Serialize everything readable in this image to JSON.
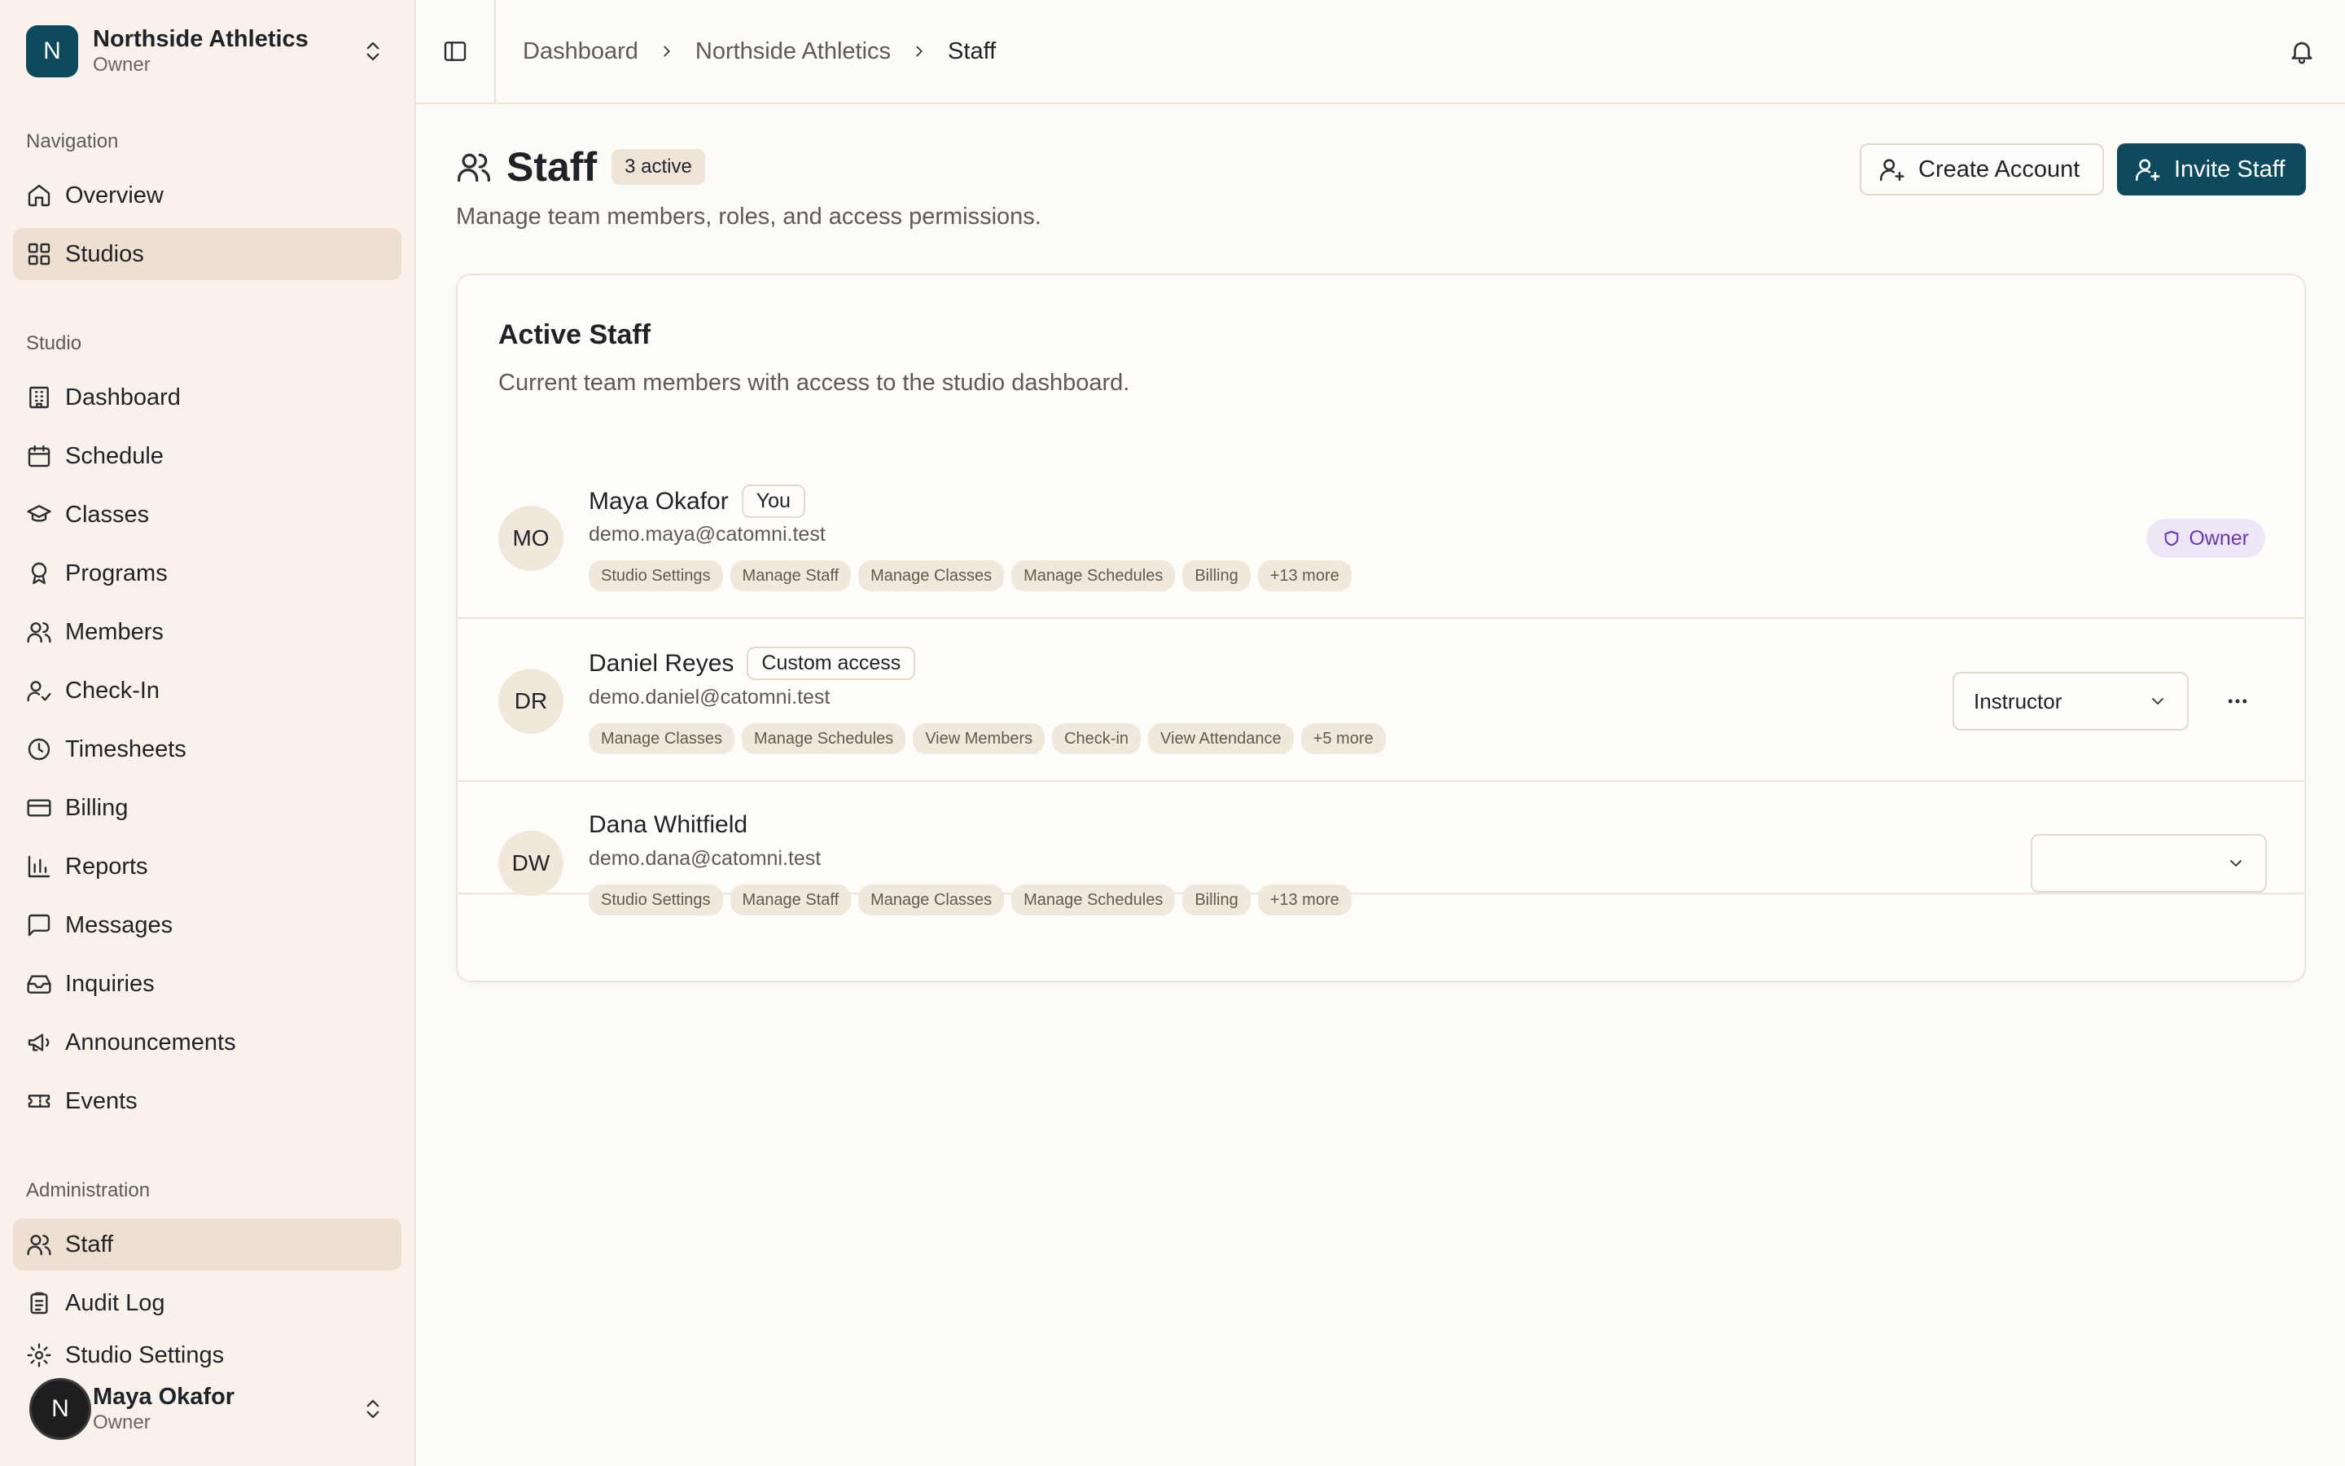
{
  "org": {
    "initial": "N",
    "name": "Northside Athletics",
    "role": "Owner"
  },
  "nav": {
    "sections": [
      {
        "label": "Navigation"
      },
      {
        "label": "Studio"
      },
      {
        "label": "Administration"
      }
    ],
    "items": [
      {
        "label": "Overview",
        "icon": "home-icon"
      },
      {
        "label": "Studios",
        "icon": "grid-icon"
      },
      {
        "label": "Dashboard",
        "icon": "building-icon"
      },
      {
        "label": "Schedule",
        "icon": "calendar-icon"
      },
      {
        "label": "Classes",
        "icon": "graduation-cap-icon"
      },
      {
        "label": "Programs",
        "icon": "award-icon"
      },
      {
        "label": "Members",
        "icon": "users-icon"
      },
      {
        "label": "Check-In",
        "icon": "user-check-icon"
      },
      {
        "label": "Timesheets",
        "icon": "clock-icon"
      },
      {
        "label": "Billing",
        "icon": "credit-card-icon"
      },
      {
        "label": "Reports",
        "icon": "bar-chart-icon"
      },
      {
        "label": "Messages",
        "icon": "message-square-icon"
      },
      {
        "label": "Inquiries",
        "icon": "inbox-icon"
      },
      {
        "label": "Announcements",
        "icon": "megaphone-icon"
      },
      {
        "label": "Events",
        "icon": "ticket-icon"
      },
      {
        "label": "Staff",
        "icon": "users-icon"
      },
      {
        "label": "Audit Log",
        "icon": "clipboard-icon"
      },
      {
        "label": "Studio Settings",
        "icon": "settings-icon"
      }
    ],
    "active": [
      "Studios",
      "Staff"
    ]
  },
  "user": {
    "initial": "N",
    "name": "Maya Okafor",
    "role": "Owner"
  },
  "breadcrumb": [
    "Dashboard",
    "Northside Athletics",
    "Staff"
  ],
  "page": {
    "title": "Staff",
    "count_badge": "3 active",
    "subtitle": "Manage team members, roles, and access permissions.",
    "create_account_label": "Create Account",
    "invite_staff_label": "Invite Staff"
  },
  "card": {
    "title": "Active Staff",
    "subtitle": "Current team members with access to the studio dashboard."
  },
  "staff": [
    {
      "initials": "MO",
      "name": "Maya Okafor",
      "tag": "You",
      "email": "demo.maya@catomni.test",
      "permissions": [
        "Studio Settings",
        "Manage Staff",
        "Manage Classes",
        "Manage Schedules",
        "Billing",
        "+13 more"
      ],
      "role_badge": "Owner"
    },
    {
      "initials": "DR",
      "name": "Daniel Reyes",
      "tag": "Custom access",
      "email": "demo.daniel@catomni.test",
      "permissions": [
        "Manage Classes",
        "Manage Schedules",
        "View Members",
        "Check-in",
        "View Attendance",
        "+5 more"
      ],
      "role_select": "Instructor"
    },
    {
      "initials": "DW",
      "name": "Dana Whitfield",
      "email": "demo.dana@catomni.test",
      "permissions": [
        "Studio Settings",
        "Manage Staff",
        "Manage Classes",
        "Manage Schedules",
        "Billing",
        "+13 more"
      ],
      "role_select": ""
    }
  ],
  "colors": {
    "brand": "#0d4a5e",
    "sidebar_bg": "#f8f2ea",
    "active_nav_bg": "#eee0d0",
    "owner_badge_text": "#6a35b6",
    "owner_badge_bg": "#ede7f7"
  }
}
